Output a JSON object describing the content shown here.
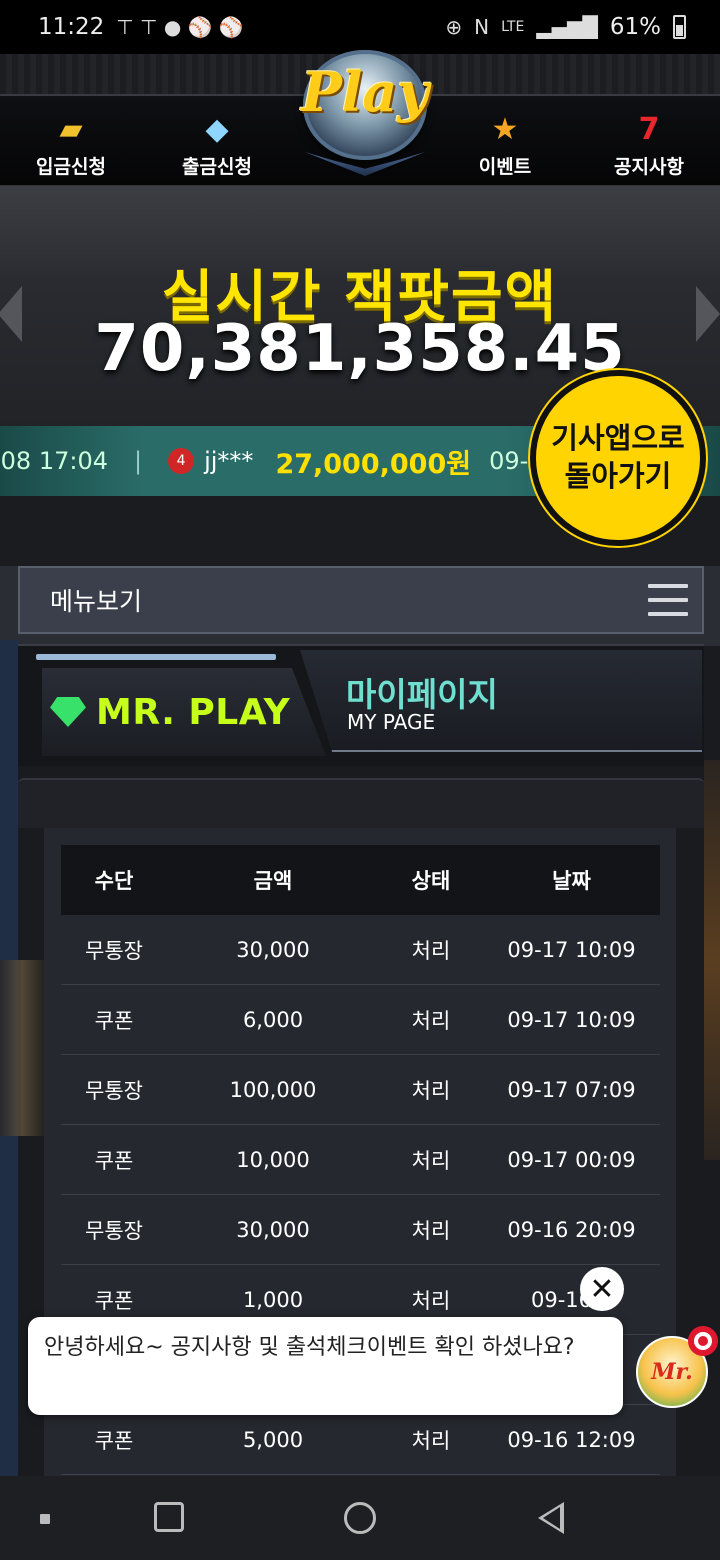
{
  "status_bar": {
    "time": "11:22",
    "battery": "61%",
    "network": "LTE"
  },
  "nav": {
    "items": [
      {
        "label": "입금신청",
        "icon": "gold-bar-icon"
      },
      {
        "label": "출금신청",
        "icon": "diamond-icon"
      },
      {
        "label": "이벤트",
        "icon": "star-icon"
      },
      {
        "label": "공지사항",
        "icon": "lucky-seven-icon"
      }
    ],
    "logo_text": "Play"
  },
  "jackpot": {
    "title": "실시간 잭팟금액",
    "amount": "70,381,358.45"
  },
  "ticker": {
    "date_left": "-08 17:04",
    "separator": "|",
    "rank": "4",
    "user": "jj***",
    "amount": "27,000,000원",
    "date_right": "09-0"
  },
  "back_button": {
    "line1": "기사앱으로",
    "line2": "돌아가기"
  },
  "menu": {
    "label": "메뉴보기"
  },
  "mypage": {
    "brand": "MR. PLAY",
    "title": "마이페이지",
    "subtitle": "MY PAGE"
  },
  "table": {
    "headers": [
      "수단",
      "금액",
      "상태",
      "날짜"
    ],
    "rows": [
      [
        "무통장",
        "30,000",
        "처리",
        "09-17 10:09"
      ],
      [
        "쿠폰",
        "6,000",
        "처리",
        "09-17 10:09"
      ],
      [
        "무통장",
        "100,000",
        "처리",
        "09-17 07:09"
      ],
      [
        "쿠폰",
        "10,000",
        "처리",
        "09-17 00:09"
      ],
      [
        "무통장",
        "30,000",
        "처리",
        "09-16 20:09"
      ],
      [
        "쿠폰",
        "1,000",
        "처리",
        "09-16 1"
      ],
      [
        "",
        "",
        "",
        ""
      ],
      [
        "쿠폰",
        "5,000",
        "처리",
        "09-16 12:09"
      ]
    ]
  },
  "chat": {
    "message": "안녕하세요~ 공지사항 및 출석체크이벤트 확인 하셨나요?",
    "close_symbol": "✕",
    "avatar_text": "Mr."
  },
  "colors": {
    "jackpot_title": "#ffe500",
    "ticker_bg": "#2a6c68",
    "brand_green": "#c6ff1a",
    "mypage_title": "#6fe0d0",
    "back_button": "#ffd400"
  }
}
